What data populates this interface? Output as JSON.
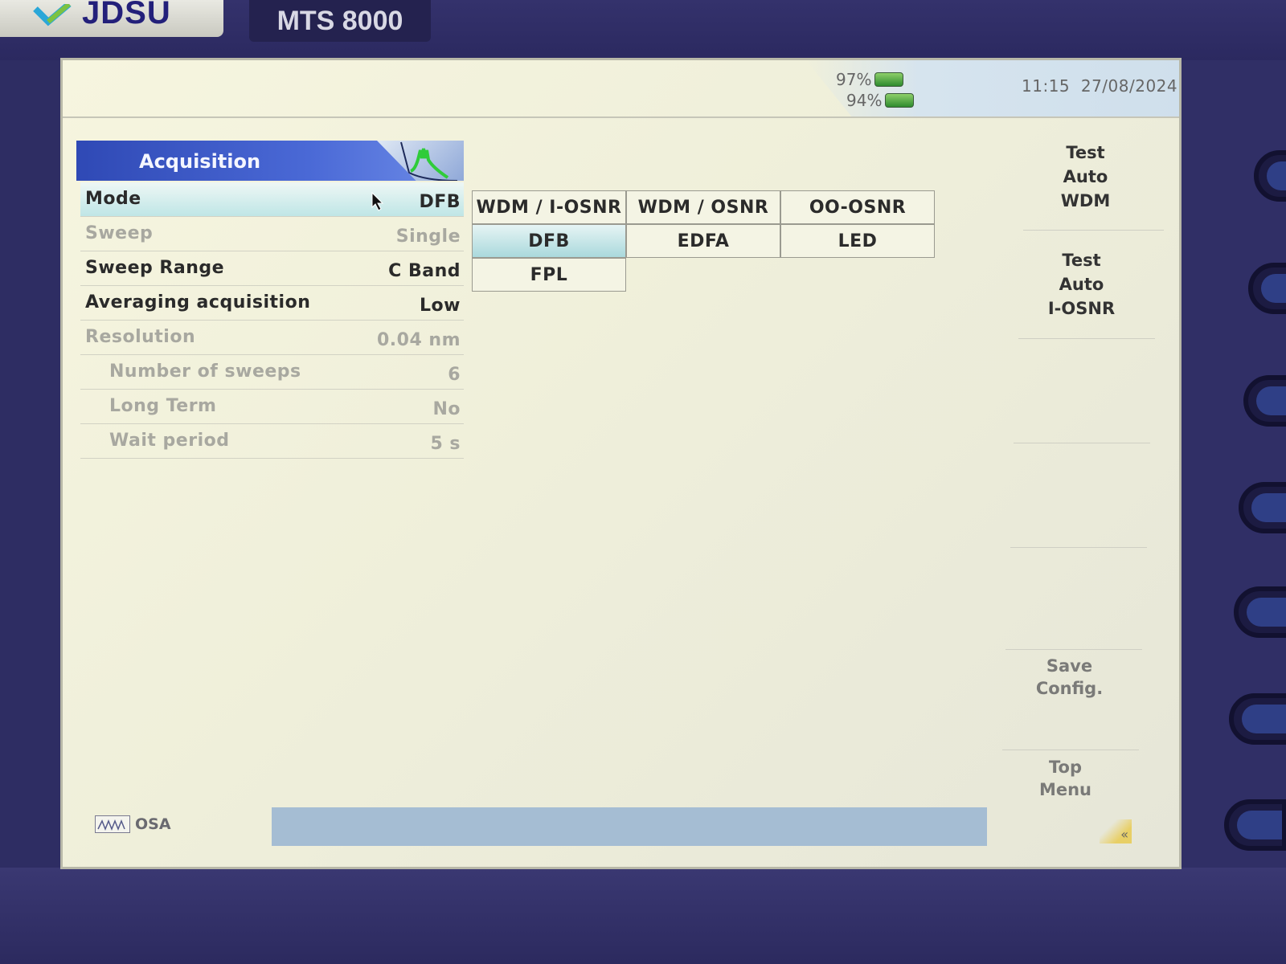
{
  "device": {
    "brand": "JDSU",
    "model": "MTS 8000"
  },
  "status": {
    "battery1": "97%",
    "battery2": "94%",
    "time": "11:15",
    "date": "27/08/2024"
  },
  "panel": {
    "title": "Acquisition",
    "rows": [
      {
        "label": "Mode",
        "value": "DFB",
        "state": "active"
      },
      {
        "label": "Sweep",
        "value": "Single",
        "state": "disabled"
      },
      {
        "label": "Sweep Range",
        "value": "C Band",
        "state": "enabled"
      },
      {
        "label": "Averaging acquisition",
        "value": "Low",
        "state": "enabled"
      },
      {
        "label": "Resolution",
        "value": "0.04 nm",
        "state": "disabled"
      },
      {
        "label": "Number of sweeps",
        "value": "6",
        "state": "disabled"
      },
      {
        "label": "Long Term",
        "value": "No",
        "state": "disabled"
      },
      {
        "label": "Wait period",
        "value": "5 s",
        "state": "disabled"
      }
    ]
  },
  "mode_options": [
    {
      "label": "WDM / I-OSNR",
      "selected": false
    },
    {
      "label": "WDM / OSNR",
      "selected": false
    },
    {
      "label": "OO-OSNR",
      "selected": false
    },
    {
      "label": "DFB",
      "selected": true
    },
    {
      "label": "EDFA",
      "selected": false
    },
    {
      "label": "LED",
      "selected": false
    },
    {
      "label": "FPL",
      "selected": false
    }
  ],
  "softkeys": {
    "test_auto_wdm": [
      "Test",
      "Auto",
      "WDM"
    ],
    "test_auto_iosnr": [
      "Test",
      "Auto",
      "I-OSNR"
    ],
    "save_config": [
      "Save",
      "Config."
    ],
    "top_menu": [
      "Top",
      "Menu"
    ]
  },
  "bottom": {
    "tab_label": "OSA"
  },
  "colors": {
    "header_blue": "#2f49b5",
    "selected_cyan": "#aad9dc",
    "screen_bg": "#f6f5df",
    "bezel": "#2e2d63"
  },
  "icons": [
    "jdsu-logo-icon",
    "spectrum-wave-icon",
    "battery-icon",
    "cursor-arrow-icon",
    "osa-spectrum-icon",
    "back-arrows-icon"
  ]
}
